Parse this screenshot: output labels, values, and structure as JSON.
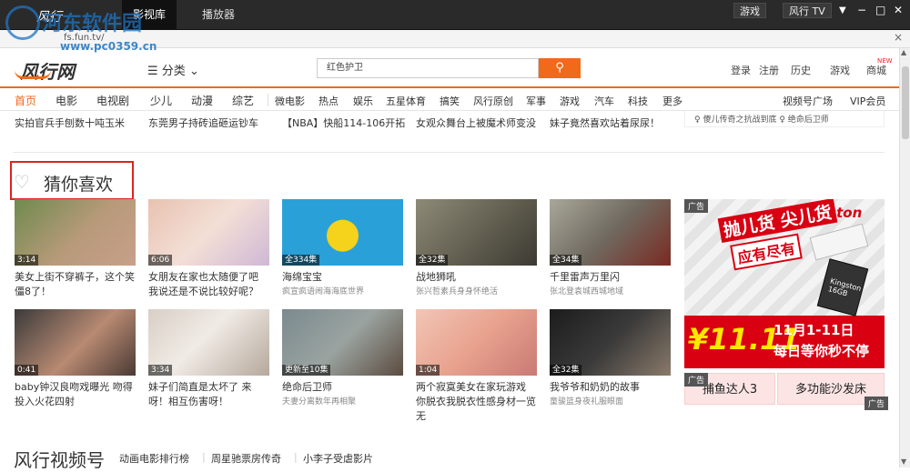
{
  "titlebar": {
    "app_name": "风行",
    "tabs": [
      "影视库",
      "播放器"
    ],
    "buttons": [
      "游戏",
      "风行 TV"
    ],
    "window_controls": [
      "▼",
      "−",
      "□",
      "✕"
    ]
  },
  "watermark": {
    "line1": "河东软件园",
    "line2": "www.pc0359.cn"
  },
  "address_bar": {
    "url": "fs.fun.tv/",
    "close": "×"
  },
  "header": {
    "brand": "风行网",
    "category": "分类",
    "search_value": "红色护卫",
    "links": [
      "登录",
      "注册",
      "历史",
      "游戏",
      "商城"
    ],
    "new_badge": "NEW"
  },
  "nav": {
    "primary": [
      "首页",
      "电影",
      "电视剧",
      "少儿",
      "动漫",
      "综艺"
    ],
    "secondary": [
      "微电影",
      "热点",
      "娱乐",
      "五星体育",
      "搞笑",
      "风行原创",
      "军事",
      "游戏",
      "汽车",
      "科技",
      "更多"
    ],
    "right": [
      "视频号广场",
      "VIP会员"
    ]
  },
  "prev_row": {
    "items": [
      "实拍官兵手刨数十吨玉米",
      "东莞男子持砖追砸运钞车",
      "【NBA】快船114-106开拓",
      "女观众舞台上被魔术师变没",
      "妹子竟然喜欢站着尿尿！"
    ],
    "side_text": "♀ 傻儿传奇之抗战到底     ♀ 绝命后卫师"
  },
  "section": {
    "title": "猜你喜欢"
  },
  "cards": [
    {
      "badge": "3:14",
      "title": "美女上街不穿裤子，这个笑僵8了！",
      "sub": ""
    },
    {
      "badge": "6:06",
      "title": "女朋友在家也太随便了吧 我说还是不说比较好呢？",
      "sub": ""
    },
    {
      "badge": "全334集",
      "title": "海绵宝宝",
      "sub": "疯宣疯语闹海海底世界"
    },
    {
      "badge": "全32集",
      "title": "战地狮吼",
      "sub": "张兴哲素兵身身怀绝活"
    },
    {
      "badge": "全34集",
      "title": "千里雷声万里闪",
      "sub": "张北登袁城西城地域"
    },
    {
      "badge": "0:41",
      "title": "baby钟汉良吻戏曝光 吻得投入火花四射",
      "sub": ""
    },
    {
      "badge": "3:34",
      "title": "妹子们简直是太坏了 来呀！相互伤害呀！",
      "sub": ""
    },
    {
      "badge": "更新至10集",
      "title": "绝命后卫师",
      "sub": "夫妻分离数年再相聚"
    },
    {
      "badge": "1:04",
      "title": "两个寂寞美女在家玩游戏 你脱衣我脱衣性感身材一览无",
      "sub": ""
    },
    {
      "badge": "全32集",
      "title": "我爷爷和奶奶的故事",
      "sub": "童骏篮身夜礼服眼面"
    }
  ],
  "ad": {
    "tag": "广告",
    "brand": "Kingston",
    "slogan1": "抛儿货 尖儿货",
    "slogan2": "应有尽有",
    "card_label": "Kingston 16GB",
    "price": "¥11.11",
    "date": "11月1-11日",
    "line": "每日等你秒不停"
  },
  "mini_ads": [
    {
      "tag": "广告",
      "text": "捕鱼达人3"
    },
    {
      "tag": "广告",
      "text": "多功能沙发床"
    }
  ],
  "bottom": {
    "title": "风行视频号",
    "links": [
      "动画电影排行榜",
      "周星驰票房传奇",
      "小李子受虐影片"
    ]
  },
  "colors": {
    "accent": "#f06a1a",
    "titlebar": "#2a2a2a",
    "ad_red": "#d90012",
    "highlight_box": "#dd2222"
  }
}
